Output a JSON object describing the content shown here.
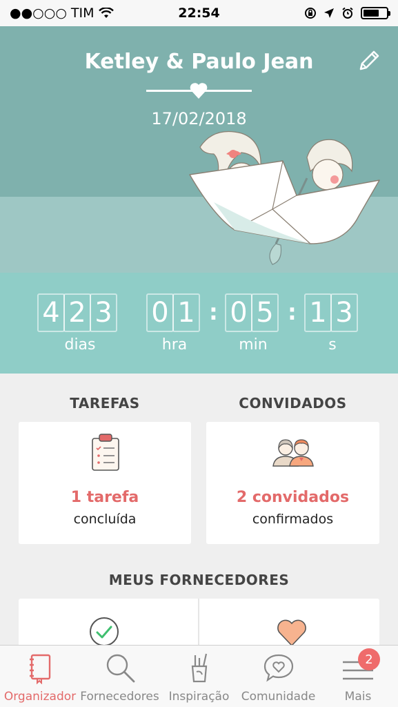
{
  "status_bar": {
    "carrier": "●●○○○ TIM",
    "time": "22:54"
  },
  "hero": {
    "couple_name": "Ketley & Paulo Jean",
    "date": "17/02/2018"
  },
  "countdown": {
    "days_digits": [
      "4",
      "2",
      "3"
    ],
    "hours_digits": [
      "0",
      "1"
    ],
    "minutes_digits": [
      "0",
      "5"
    ],
    "seconds_digits": [
      "1",
      "3"
    ],
    "labels": {
      "days": "dias",
      "hours": "hra",
      "minutes": "min",
      "seconds": "s"
    },
    "separator": ":"
  },
  "tasks": {
    "section_title": "TAREFAS",
    "count": "1 tarefa",
    "status": "concluída"
  },
  "guests": {
    "section_title": "CONVIDADOS",
    "count": "2 convidados",
    "status": "confirmados"
  },
  "vendors": {
    "section_title": "MEUS FORNECEDORES"
  },
  "tab_bar": {
    "tabs": [
      {
        "label": "Organizador",
        "icon": "notebook-icon",
        "active": true
      },
      {
        "label": "Fornecedores",
        "icon": "search-icon",
        "active": false
      },
      {
        "label": "Inspiração",
        "icon": "art-supplies-icon",
        "active": false
      },
      {
        "label": "Comunidade",
        "icon": "chat-heart-icon",
        "active": false
      },
      {
        "label": "Mais",
        "icon": "menu-icon",
        "active": false,
        "badge": "2"
      }
    ]
  },
  "colors": {
    "accent": "#e36a6a",
    "hero_bg": "#7fb1ad",
    "countdown_bg": "#8fcdc7"
  }
}
